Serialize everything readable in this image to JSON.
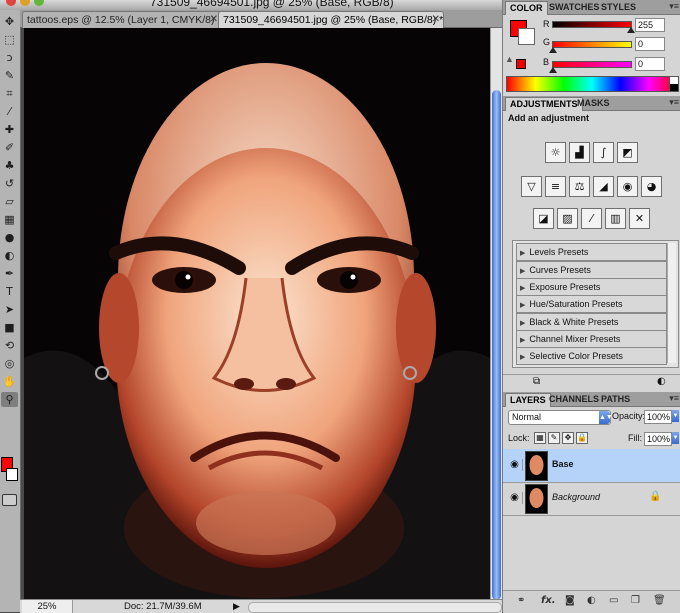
{
  "window": {
    "title": "731509_46694501.jpg @ 25% (Base, RGB/8)"
  },
  "doc_tabs": [
    {
      "label": "tattoos.eps @ 12.5% (Layer 1, CMYK/8)",
      "close": "✕"
    },
    {
      "label": "731509_46694501.jpg @ 25% (Base, RGB/8) *",
      "close": "✕"
    }
  ],
  "status": {
    "zoom": "25%",
    "doc": "Doc: 21.7M/39.6M",
    "arrow": "▶"
  },
  "color_panel": {
    "tabs": [
      "COLOR",
      "SWATCHES",
      "STYLES"
    ],
    "channels": [
      {
        "label": "R",
        "value": "255",
        "level": 1.0
      },
      {
        "label": "G",
        "value": "0",
        "level": 0.0
      },
      {
        "label": "B",
        "value": "0",
        "level": 0.0
      }
    ],
    "foreground": "#ff0000",
    "background": "#ffffff",
    "warning_glyph": "▲"
  },
  "adjustments_panel": {
    "tabs": [
      "ADJUSTMENTS",
      "MASKS"
    ],
    "heading": "Add an adjustment",
    "icons_row1": [
      "brightness-contrast-icon",
      "levels-icon",
      "curves-icon",
      "exposure-icon"
    ],
    "icons_row2": [
      "vibrance-icon",
      "hue-saturation-icon",
      "color-balance-icon",
      "black-white-icon",
      "photo-filter-icon",
      "channel-mixer-icon"
    ],
    "icons_row3": [
      "invert-icon",
      "posterize-icon",
      "threshold-icon",
      "gradient-map-icon",
      "selective-color-icon"
    ],
    "presets": [
      "Levels Presets",
      "Curves Presets",
      "Exposure Presets",
      "Hue/Saturation Presets",
      "Black & White Presets",
      "Channel Mixer Presets",
      "Selective Color Presets"
    ]
  },
  "layers_panel": {
    "tabs": [
      "LAYERS",
      "CHANNELS",
      "PATHS"
    ],
    "blend_mode": "Normal",
    "opacity_label": "Opacity:",
    "opacity": "100%",
    "lock_label": "Lock:",
    "fill_label": "Fill:",
    "fill": "100%",
    "layers": [
      {
        "name": "Base",
        "selected": true
      },
      {
        "name": "Background",
        "selected": false,
        "locked": true
      }
    ],
    "footer_icons": [
      "link-icon",
      "fx-icon",
      "mask-icon",
      "adjustment-layer-icon",
      "group-icon",
      "new-layer-icon",
      "trash-icon"
    ]
  },
  "colors": {
    "accent_blue": "#3a6ccc",
    "selected_row": "#b5d3f8"
  }
}
